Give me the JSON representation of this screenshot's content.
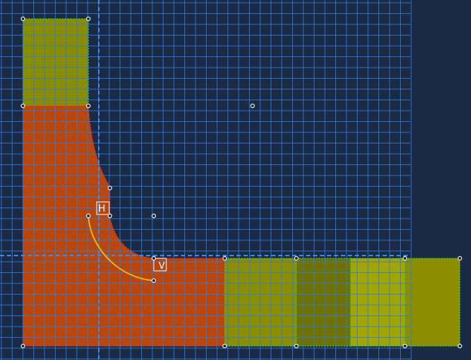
{
  "app": {
    "view": "sketch-canvas"
  },
  "colors": {
    "background": "#1b2a45",
    "grid_line": "#2f7de0",
    "axis_line": "#3a8cf5",
    "material_orange": "#c24a0c",
    "material_orange_dark": "#9e3a07",
    "material_olive": "#8a8e00",
    "material_olive_dark": "#6f7200",
    "material_olive_light": "#a2a500",
    "selection_yellow": "#f0c000",
    "edge_red": "#ff2a2a",
    "edge_green": "#2fcf4a",
    "vertex_white": "#f0f0f0"
  },
  "regions": [
    {
      "name": "top-left-block",
      "material": "olive"
    },
    {
      "name": "elbow-region",
      "material": "orange"
    },
    {
      "name": "bottom-block-1",
      "material": "olive"
    },
    {
      "name": "bottom-block-2",
      "material": "olive-dark"
    },
    {
      "name": "bottom-block-3",
      "material": "olive-light"
    },
    {
      "name": "bottom-block-4",
      "material": "olive"
    }
  ],
  "constraint_glyphs": [
    {
      "name": "horizontal-constraint-icon",
      "text": "H"
    },
    {
      "name": "vertical-constraint-icon",
      "text": "V"
    }
  ]
}
